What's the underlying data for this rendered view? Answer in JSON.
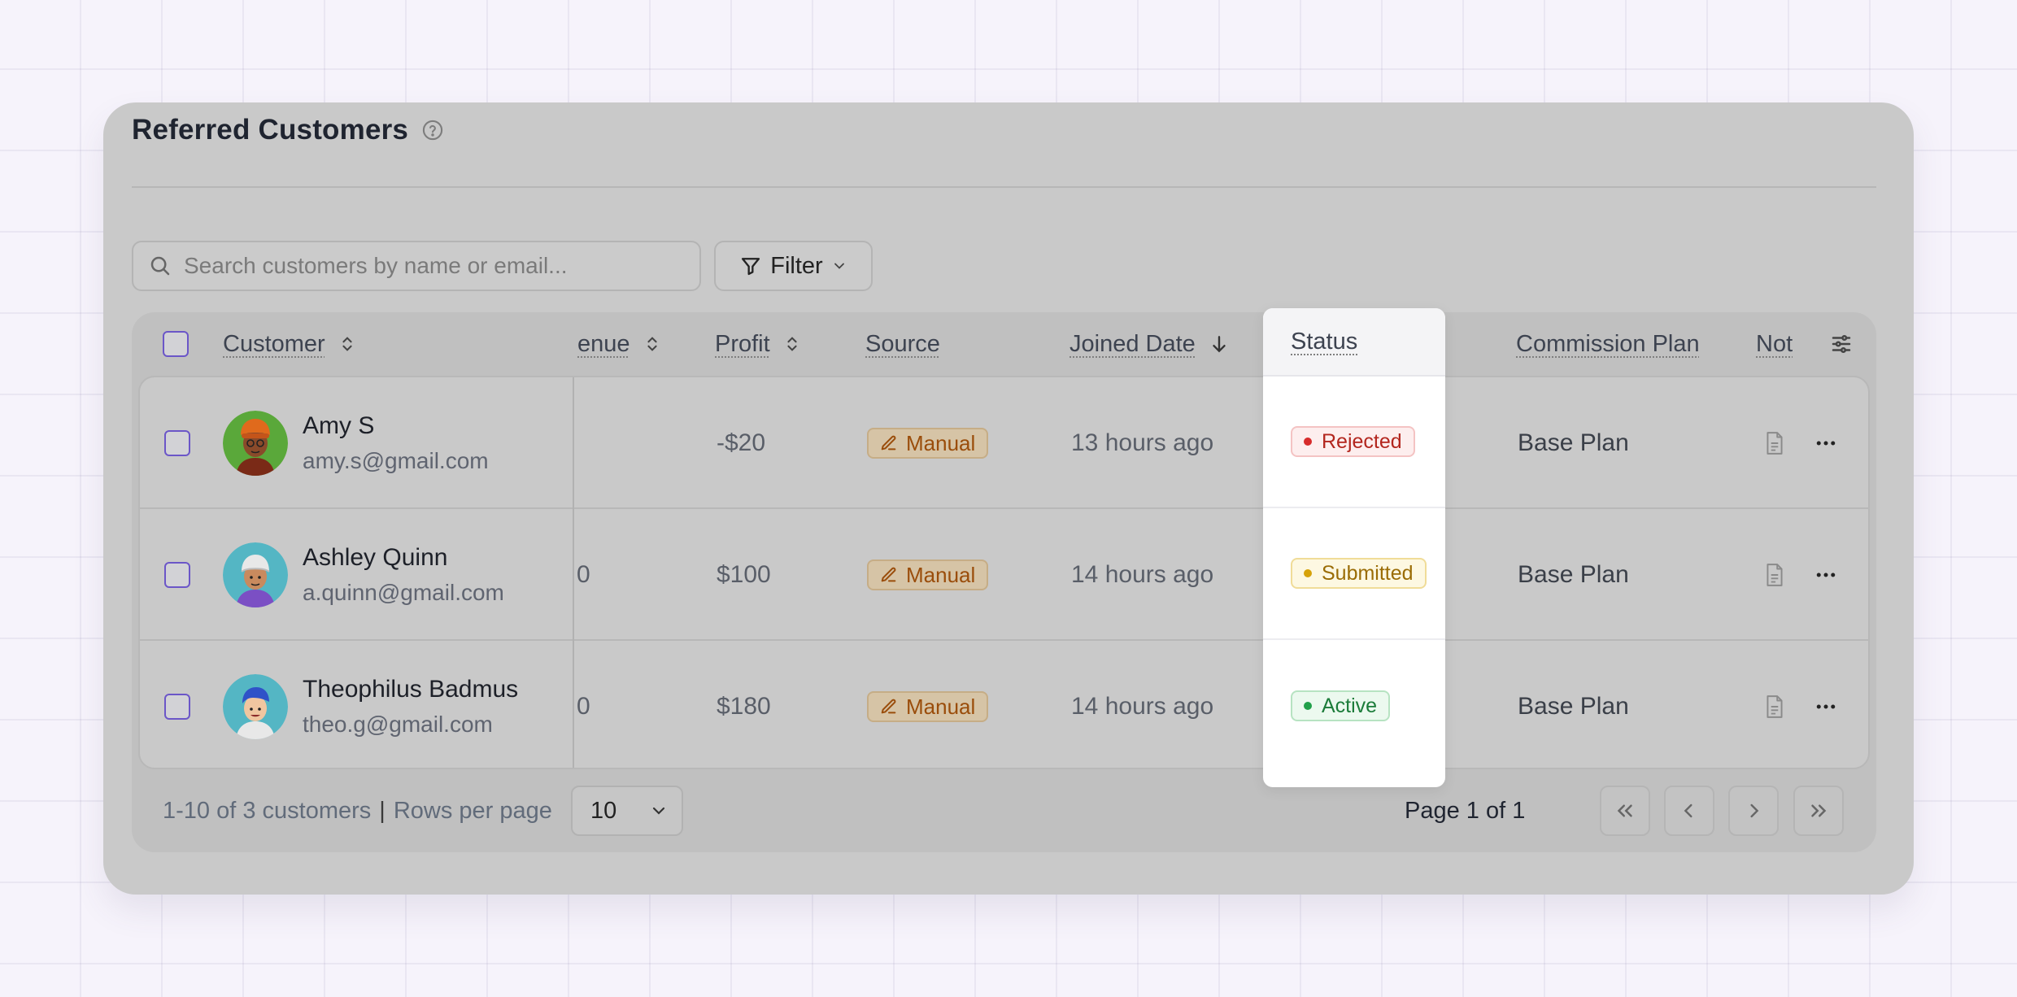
{
  "card": {
    "title": "Referred Customers"
  },
  "toolbar": {
    "search_placeholder": "Search customers by name or email...",
    "filter_label": "Filter"
  },
  "table": {
    "columns": {
      "customer": "Customer",
      "revenue": "enue",
      "profit": "Profit",
      "source": "Source",
      "joined": "Joined Date",
      "status": "Status",
      "commission": "Commission Plan",
      "notes": "Not"
    },
    "rows": [
      {
        "name": "Amy S",
        "email": "amy.s@gmail.com",
        "revenue": "",
        "profit": "-$20",
        "source": "Manual",
        "joined": "13 hours ago",
        "status": "Rejected",
        "plan": "Base Plan"
      },
      {
        "name": "Ashley Quinn",
        "email": "a.quinn@gmail.com",
        "revenue": "0",
        "profit": "$100",
        "source": "Manual",
        "joined": "14 hours ago",
        "status": "Submitted",
        "plan": "Base Plan"
      },
      {
        "name": "Theophilus Badmus",
        "email": "theo.g@gmail.com",
        "revenue": "0",
        "profit": "$180",
        "source": "Manual",
        "joined": "14 hours ago",
        "status": "Active",
        "plan": "Base Plan"
      }
    ]
  },
  "footer": {
    "range": "1-10 of 3 customers",
    "separator": "|",
    "rows_per_page_label": "Rows per page",
    "rows_per_page_value": "10",
    "page_label": "Page 1 of 1"
  },
  "colors": {
    "accent": "#6b56c8",
    "rejected": "#d72b2b",
    "submitted": "#d6a20a",
    "active": "#21a04a"
  },
  "icons": [
    "help-circle-icon",
    "search-icon",
    "filter-icon",
    "chevron-down-icon",
    "sort-icon",
    "arrow-down-icon",
    "edit-icon",
    "document-icon",
    "more-icon",
    "settings-sliders-icon",
    "first-page-icon",
    "prev-page-icon",
    "next-page-icon",
    "last-page-icon"
  ]
}
